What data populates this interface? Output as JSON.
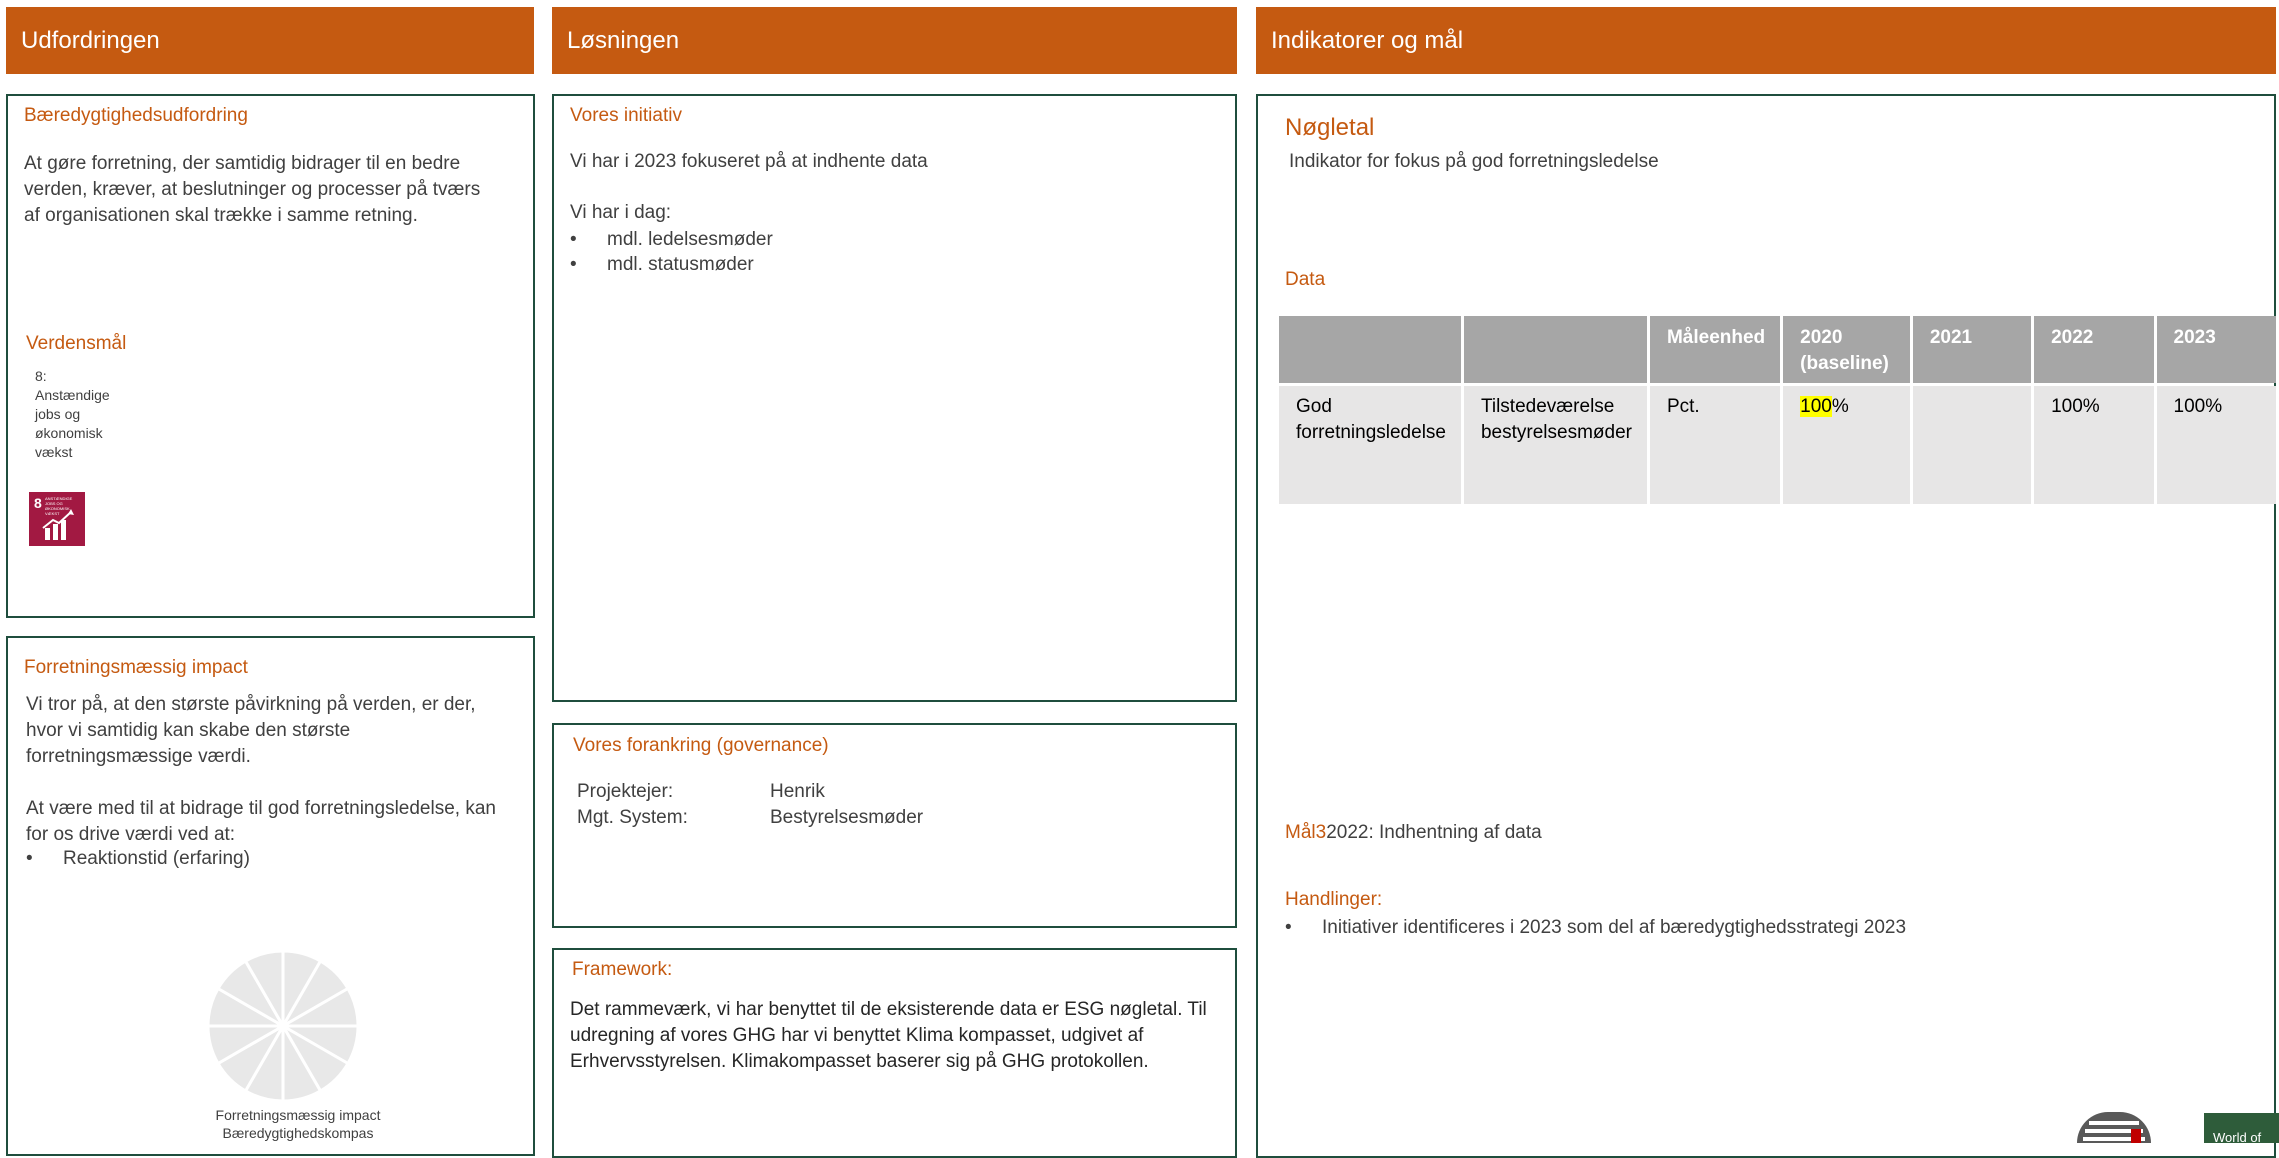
{
  "headers": {
    "col1": "Udfordringen",
    "col2": "Løsningen",
    "col3": "Indikatorer og mål"
  },
  "challenge": {
    "title": "Bæredygtighedsudfordring",
    "text": "At gøre forretning, der samtidig bidrager til en bedre verden, kræver, at beslutninger og processer på tværs af organisationen skal trække i samme retning.",
    "goals_title": "Verdensmål",
    "goal_label_lines": [
      "8:",
      "Anstændige",
      "jobs og",
      "økonomisk",
      "vækst"
    ],
    "sdg_icon_number": "8",
    "sdg_icon_text": "ANSTÆNDIGE JOBS OG ØKONOMISK VÆKST",
    "sdg_color": "#a21942"
  },
  "impact": {
    "title": "Forretningsmæssig impact",
    "text1": "Vi tror på, at den største påvirkning på verden, er der, hvor vi samtidig kan skabe den største forretningsmæssige værdi.",
    "text2": "At være med til at bidrage til god forretningsledelse, kan for os drive værdi ved at:",
    "bullets": [
      "Reaktionstid (erfaring)"
    ],
    "compass_caption_1": "Forretningsmæssig impact",
    "compass_caption_2": "Bæredygtighedskompas"
  },
  "initiative": {
    "title": "Vores initiativ",
    "text1": "Vi har i 2023 fokuseret på at indhente data",
    "text2": "Vi har i dag:",
    "bullets": [
      "mdl. ledelsesmøder",
      "mdl. statusmøder"
    ]
  },
  "governance": {
    "title": "Vores forankring (governance)",
    "rows": [
      {
        "label": "Projektejer:",
        "value": "Henrik"
      },
      {
        "label": "Mgt. System:",
        "value": "Bestyrelsesmøder"
      }
    ]
  },
  "framework": {
    "title": "Framework:",
    "text": "Det rammeværk, vi har benyttet til de eksisterende data er ESG nøgletal. Til udregning af vores GHG har vi benyttet Klima kompasset, udgivet af Erhvervsstyrelsen. Klimakompasset baserer sig på GHG protokollen."
  },
  "indicators": {
    "title": "Nøgletal",
    "subtitle": "Indikator for fokus på god forretningsledelse",
    "data_title": "Data",
    "table": {
      "headers": [
        "",
        "",
        "Måleenhed",
        "2020 (baseline)",
        "2021",
        "2022",
        "2023"
      ],
      "row": {
        "c1": "God forretningsledelse",
        "c2": "Tilstedeværelse bestyrelsesmøder",
        "c3": "Pct.",
        "c4_highlight": "100",
        "c4_rest": "%",
        "c5": "",
        "c6": "100%",
        "c7": "100%"
      }
    },
    "goal_label": "Mål3",
    "goal_text": "2022: Indhentning af data",
    "actions_title": "Handlinger:",
    "actions": [
      "Initiativer identificeres i 2023 som del af bæredygtighedsstrategi 2023"
    ]
  },
  "footer": {
    "badge_text": "World of"
  },
  "colors": {
    "accent": "#c55a11",
    "border": "#1f4e3d",
    "table_header": "#a6a6a6",
    "table_cell": "#e7e6e6",
    "highlight": "#ffff00"
  }
}
